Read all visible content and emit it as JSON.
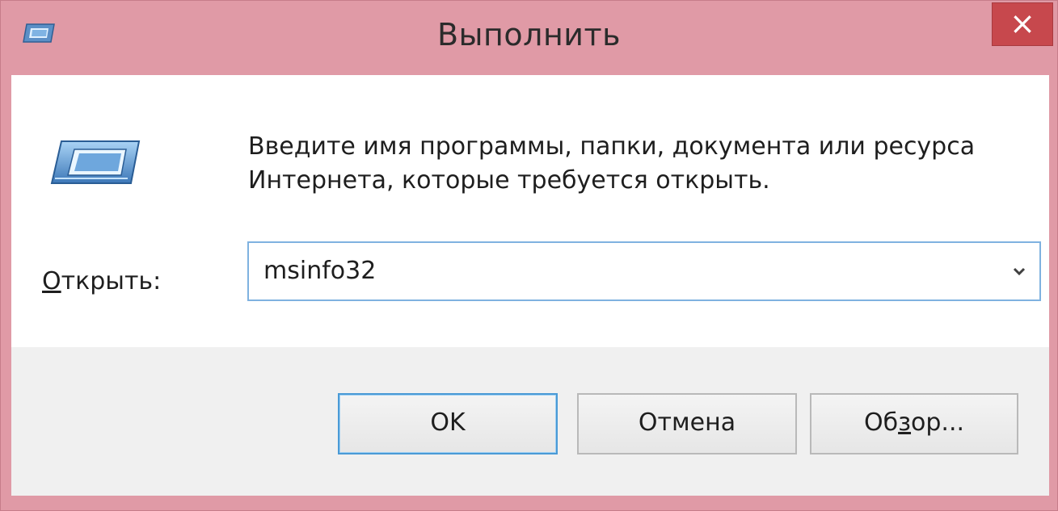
{
  "window": {
    "title": "Выполнить",
    "close_glyph": "×",
    "title_icon": "run-icon"
  },
  "content": {
    "icon": "run-icon",
    "description": "Введите имя программы, папки, документа или ресурса Интернета, которые требуется открыть.",
    "open_label_prefix": "О",
    "open_label_rest": "ткрыть:",
    "open_value": "msinfo32"
  },
  "buttons": {
    "ok_label": "OK",
    "cancel_label": "Отмена",
    "browse_prefix": "Об",
    "browse_accel": "з",
    "browse_rest": "ор..."
  },
  "colors": {
    "titlebar": "#e09aa6",
    "close_button": "#c7484d",
    "input_border": "#7fb2e0",
    "default_button_border": "#4a9ad6",
    "footer": "#f0f0f0"
  }
}
